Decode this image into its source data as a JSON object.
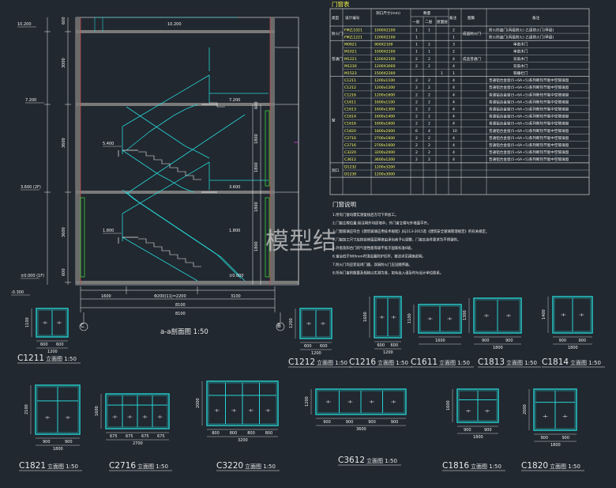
{
  "table": {
    "title": "门窗表",
    "headers": {
      "type": "类型",
      "code": "设计编号",
      "size": "洞口尺寸(mm)",
      "qty": "数量",
      "f1": "一层",
      "f2": "二层",
      "f3": "屋面层",
      "total_note": "备注",
      "style": "图集",
      "remark": "备注"
    },
    "groups": [
      {
        "name": "防火门",
        "rows": [
          {
            "code": "FM乙1021",
            "size": "1000X2100",
            "f1": "1",
            "f2": "1",
            "f3": "",
            "total": "2"
          },
          {
            "code": "FM乙1221",
            "size": "1200X2100",
            "f1": "1",
            "f2": "",
            "f3": "",
            "total": "1"
          }
        ]
      },
      {
        "name": "普通门",
        "rows": [
          {
            "code": "M0921",
            "size": "900X2100",
            "f1": "1",
            "f2": "2",
            "f3": "",
            "total": "3"
          },
          {
            "code": "M1021",
            "size": "1000X2100",
            "f1": "1",
            "f2": "1",
            "f3": "",
            "total": "2"
          },
          {
            "code": "M1221",
            "size": "1200X2100",
            "f1": "2",
            "f2": "2",
            "f3": "",
            "total": "4"
          },
          {
            "code": "M1230",
            "size": "1200X3000",
            "f1": "2",
            "f2": "2",
            "f3": "",
            "total": "4"
          },
          {
            "code": "M1523",
            "size": "1500X2300",
            "f1": "",
            "f2": "",
            "f3": "1",
            "total": "1"
          }
        ]
      },
      {
        "name": "窗",
        "rows": [
          {
            "code": "C1211",
            "size": "1200x1100",
            "f1": "2",
            "f2": "2",
            "f3": "",
            "total": "4"
          },
          {
            "code": "C1212",
            "size": "1200x1200",
            "f1": "2",
            "f2": "2",
            "f3": "",
            "total": "4"
          },
          {
            "code": "C1216",
            "size": "1200x1600",
            "f1": "2",
            "f2": "2",
            "f3": "",
            "total": "4"
          },
          {
            "code": "C1611",
            "size": "1600x1100",
            "f1": "2",
            "f2": "2",
            "f3": "",
            "total": "4"
          },
          {
            "code": "C1613",
            "size": "1600x1300",
            "f1": "2",
            "f2": "2",
            "f3": "",
            "total": "4"
          },
          {
            "code": "C1614",
            "size": "1600x1400",
            "f1": "2",
            "f2": "2",
            "f3": "",
            "total": "4"
          },
          {
            "code": "C1616",
            "size": "1600x1600",
            "f1": "2",
            "f2": "2",
            "f3": "",
            "total": "4"
          },
          {
            "code": "C1820",
            "size": "1800x2000",
            "f1": "6",
            "f2": "4",
            "f3": "",
            "total": "10"
          },
          {
            "code": "C2716",
            "size": "2700x1600",
            "f1": "2",
            "f2": "2",
            "f3": "",
            "total": "4"
          },
          {
            "code": "C2716",
            "size": "2700x1600",
            "f1": "2",
            "f2": "2",
            "f3": "",
            "total": "4"
          },
          {
            "code": "C3220",
            "size": "3200x2000",
            "f1": "2",
            "f2": "2",
            "f3": "",
            "total": "4"
          },
          {
            "code": "C3612",
            "size": "3600x1200",
            "f1": "2",
            "f2": "2",
            "f3": "",
            "total": "4"
          }
        ]
      },
      {
        "name": "洞口",
        "rows": [
          {
            "code": "D1232",
            "size": "1200x3200",
            "f1": "",
            "f2": "",
            "f3": "",
            "total": ""
          },
          {
            "code": "D1230",
            "size": "1200x3000",
            "f1": "",
            "f2": "",
            "f3": "",
            "total": ""
          }
        ]
      }
    ],
    "style_fire": "成品防火门",
    "style_door": "成品普通门",
    "remark_fire": "防火防盗门(丙级防火) 乙级防火门(甲级)",
    "remark_door_lines": [
      "单扇木门",
      "单扇木门",
      "双扇木门",
      "双扇木门",
      "铁栅栏门"
    ],
    "remark_window": "普通铝合金窗(5+6A+5)系列断热节能中空玻璃窗"
  },
  "notes": {
    "title": "门窗说明",
    "lines": [
      "1.所有门窗均需实测复核后方可下单加工。",
      "2.门窗立樘位置:除注明外均居墙中，外门窗立樘与外墙面平齐。",
      "3.门窗玻璃应符合《建筑玻璃应用技术规程》JGJ113-2015及《建筑安全玻璃管理规定》的有关规定。",
      "4.门窗加工尺寸应按装修面层厚度由承包商予以调整，门窗五金件要求为不锈钢件。",
      "5.外窗及阳台门的气密性能等级不低于国家标准6级。",
      "6.窗台低于900mm时须设置防护栏杆，做法详见建施说明。",
      "7.防火门均应装设闭门器，双扇防火门应设顺序器。",
      "8.所有门窗的数量及规格以实测为准，如有出入请及时与设计单位联系。"
    ]
  },
  "section": {
    "caption": "a-a剖面图 1:50",
    "axis_c": "C",
    "axis_b": "B",
    "levels": [
      "10.200",
      "7.200",
      "5.400",
      "3.600 (2F)",
      "1.800",
      "±0.000 (1F)",
      "-0.300"
    ],
    "levels_right": [
      "10.200",
      "7.200",
      "3.600",
      "1.800",
      "±0.000"
    ],
    "dims_left": [
      "600",
      "3000",
      "3600",
      "3600",
      "600"
    ],
    "dims_bottom": [
      "1600",
      "Φ200(11)=2200",
      "3100"
    ],
    "dims_total": [
      "8100",
      "8100"
    ],
    "dims_right": [
      "600",
      "1800",
      "1800",
      "1800",
      "1800"
    ]
  },
  "elevations": [
    {
      "caption": "C1211",
      "suffix": "立面图 1:50",
      "dims": [
        "600",
        "600",
        "1200",
        "1100"
      ]
    },
    {
      "caption": "C1212",
      "suffix": "立面图 1:50",
      "dims": [
        "600",
        "600",
        "1200",
        "1200"
      ]
    },
    {
      "caption": "C1216",
      "suffix": "立面图 1:50",
      "dims": [
        "600",
        "600",
        "1200",
        "1600"
      ]
    },
    {
      "caption": "C1611",
      "suffix": "立面图 1:50",
      "dims": [
        "1600",
        "1100"
      ]
    },
    {
      "caption": "C1813",
      "suffix": "立面图 1:50",
      "dims": [
        "900",
        "900",
        "1800",
        "1300"
      ]
    },
    {
      "caption": "C1814",
      "suffix": "立面图 1:50",
      "dims": [
        "900",
        "900",
        "1800",
        "1400"
      ]
    },
    {
      "caption": "C1821",
      "suffix": "立面图 1:50",
      "dims": [
        "900",
        "900",
        "1800",
        "2100"
      ]
    },
    {
      "caption": "C2716",
      "suffix": "立面图 1:50",
      "dims": [
        "675",
        "675",
        "675",
        "675",
        "2700",
        "1600"
      ]
    },
    {
      "caption": "C3220",
      "suffix": "立面图 1:50",
      "dims": [
        "800",
        "800",
        "800",
        "800",
        "3200",
        "2000"
      ]
    },
    {
      "caption": "C3612",
      "suffix": "立面图 1:50",
      "dims": [
        "900",
        "900",
        "900",
        "900",
        "3600",
        "1200"
      ]
    },
    {
      "caption": "C1816",
      "suffix": "立面图 1:50",
      "dims": [
        "900",
        "900",
        "1800",
        "1600"
      ]
    },
    {
      "caption": "C1820",
      "suffix": "立面图 1:50",
      "dims": [
        "900",
        "900",
        "1800",
        "2000"
      ]
    }
  ],
  "watermark": "模型结",
  "colors": {
    "background": "#212830",
    "cyan": "#27d3d3",
    "yellow": "#f2f24a",
    "white": "#f0f0f0",
    "red": "#e04040",
    "magenta": "#d040d0",
    "green": "#3ccf3c"
  }
}
